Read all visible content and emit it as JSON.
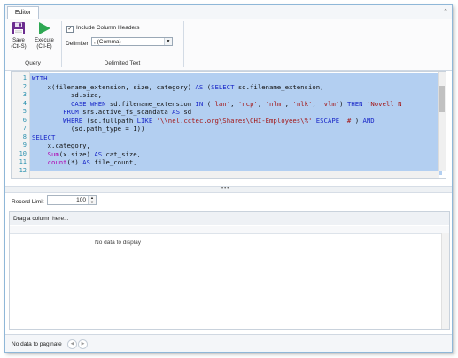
{
  "tabs": [
    {
      "label": "Editor"
    }
  ],
  "ribbon": {
    "save": {
      "label": "Save",
      "shortcut": "(Ctl-S)"
    },
    "execute": {
      "label": "Execute",
      "shortcut": "(Ctl-E)"
    },
    "query_group": "Query",
    "include_headers": {
      "label": "Include Column Headers",
      "checked": true
    },
    "delimiter": {
      "label": "Delimiter",
      "value": ", (Comma)"
    },
    "delimited_group": "Delimited Text"
  },
  "editor": {
    "lines": [
      {
        "n": "1"
      },
      {
        "n": "2"
      },
      {
        "n": "3"
      },
      {
        "n": "4"
      },
      {
        "n": "5"
      },
      {
        "n": "6"
      },
      {
        "n": "7"
      },
      {
        "n": "8"
      },
      {
        "n": "9"
      },
      {
        "n": "10"
      },
      {
        "n": "11"
      },
      {
        "n": "12"
      }
    ],
    "code": {
      "l1": "WITH",
      "l2a": "    x(filename_extension, size, category) ",
      "l2b": "AS",
      "l2c": " (",
      "l2d": "SELECT",
      "l2e": " sd.filename_extension,",
      "l3": "          sd.size,",
      "l4a": "          ",
      "l4b": "CASE WHEN",
      "l4c": " sd.filename_extension ",
      "l4d": "IN",
      "l4e": " (",
      "l4f": "'lan'",
      "l4g": ", ",
      "l4h": "'ncp'",
      "l4i": ", ",
      "l4j": "'nlm'",
      "l4k": ", ",
      "l4l": "'nlk'",
      "l4m": ", ",
      "l4n": "'vlm'",
      "l4o": ") ",
      "l4p": "THEN",
      "l4q": " ",
      "l4r": "'Novell N",
      "l5a": "        ",
      "l5b": "FROM",
      "l5c": " srs.active_fs_scandata ",
      "l5d": "AS",
      "l5e": " sd",
      "l6a": "        ",
      "l6b": "WHERE",
      "l6c": " (sd.fullpath ",
      "l6d": "LIKE",
      "l6e": " ",
      "l6f": "'\\\\nel.cctec.org\\Shares\\CHI-Employees\\%'",
      "l6g": " ",
      "l6h": "ESCAPE",
      "l6i": " ",
      "l6j": "'#'",
      "l6k": ") ",
      "l6l": "AND",
      "l7": "          (sd.path_type = 1))",
      "l8": "SELECT",
      "l9": "    x.category,",
      "l10a": "    ",
      "l10b": "Sum",
      "l10c": "(x.size) ",
      "l10d": "AS",
      "l10e": " cat_size,",
      "l11a": "    ",
      "l11b": "count",
      "l11c": "(*) ",
      "l11d": "AS",
      "l11e": " file_count,"
    }
  },
  "record_limit": {
    "label": "Record Limit",
    "value": "100"
  },
  "grid": {
    "group_panel": "Drag a column here...",
    "empty": "No data to display"
  },
  "pager": {
    "text": "No data to paginate"
  },
  "colors": {
    "selection": "#b3cff1",
    "keyword": "#1a28c8",
    "string": "#a31515",
    "function": "#b000b0",
    "line_number": "#2b91af"
  }
}
